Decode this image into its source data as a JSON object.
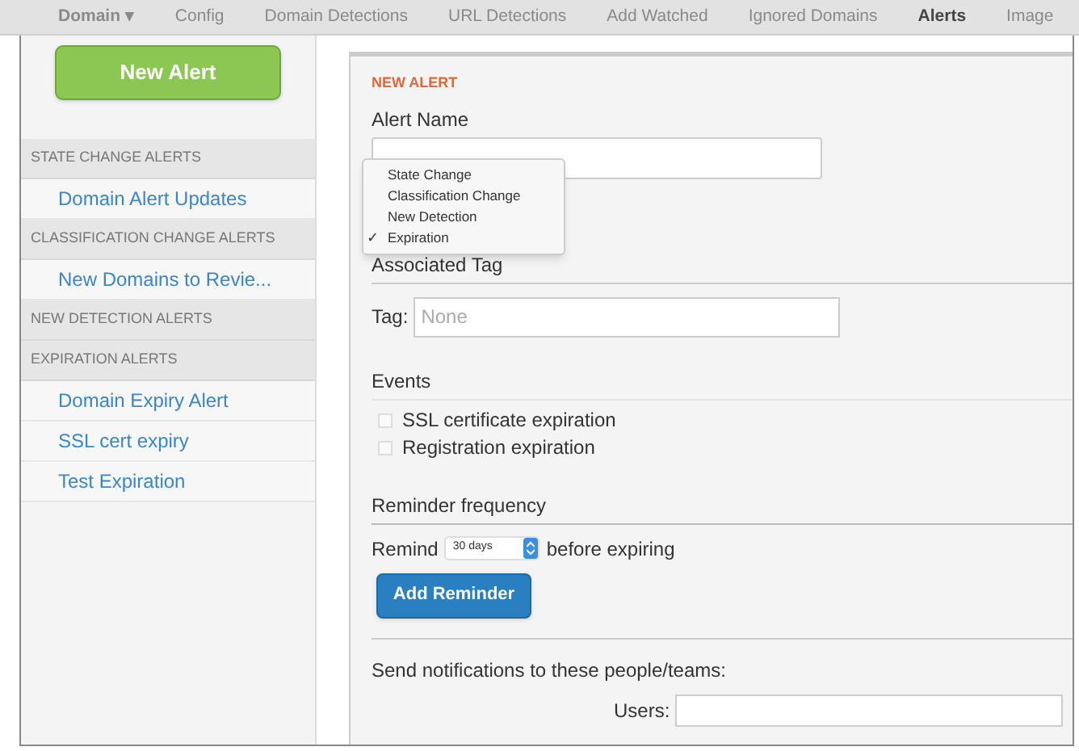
{
  "nav": [
    {
      "label": "Domain ▾",
      "selected": false,
      "kind": "menu"
    },
    {
      "label": "Config",
      "selected": false,
      "kind": "link"
    },
    {
      "label": "Domain Detections",
      "selected": false,
      "kind": "link"
    },
    {
      "label": "URL Detections",
      "selected": false,
      "kind": "link"
    },
    {
      "label": "Add Watched",
      "selected": false,
      "kind": "link"
    },
    {
      "label": "Ignored Domains",
      "selected": false,
      "kind": "link"
    },
    {
      "label": "Alerts",
      "selected": true,
      "kind": "link"
    },
    {
      "label": "Image",
      "selected": false,
      "kind": "link"
    }
  ],
  "sidebar": {
    "new_button": "New Alert",
    "groups": [
      {
        "heading": "STATE CHANGE ALERTS",
        "items": [
          "Domain Alert Updates"
        ]
      },
      {
        "heading": "CLASSIFICATION CHANGE ALERTS",
        "items": [
          "New Domains to Revie..."
        ]
      },
      {
        "heading": "NEW DETECTION ALERTS"
      },
      {
        "heading": "EXPIRATION ALERTS",
        "items": [
          "Domain Expiry Alert",
          "SSL cert expiry",
          "Test Expiration"
        ]
      }
    ]
  },
  "form": {
    "title": "NEW ALERT",
    "name_label": "Alert Name",
    "check_mark": "✓",
    "type_menu": [
      {
        "label": "State Change",
        "selected": false
      },
      {
        "label": "Classification Change",
        "selected": false
      },
      {
        "label": "New Detection",
        "selected": false
      },
      {
        "label": "Expiration",
        "selected": true
      }
    ],
    "tag_section": "Associated Tag",
    "tag_label": "Tag:",
    "tag_placeholder": "None",
    "events_section": "Events",
    "events": [
      {
        "label": "SSL certificate expiration",
        "checked": false
      },
      {
        "label": "Registration expiration",
        "checked": false
      }
    ],
    "reminder_section": "Reminder frequency",
    "remind_label": "Remind",
    "remind_value": "30 days",
    "remind_suffix": "before expiring",
    "add_reminder": "Add Reminder",
    "notify_label": "Send notifications to these people/teams:",
    "users_label": "Users:"
  }
}
